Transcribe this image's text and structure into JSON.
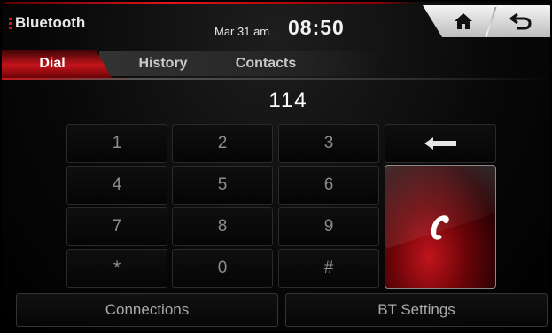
{
  "header": {
    "app_title": "Bluetooth",
    "date": "Mar 31 am",
    "time": "08:50",
    "home_icon": "home-icon",
    "back_icon": "back-arrow-icon",
    "accent_color": "#d2141c"
  },
  "tabs": [
    {
      "label": "Dial",
      "active": true
    },
    {
      "label": "History",
      "active": false
    },
    {
      "label": "Contacts",
      "active": false
    }
  ],
  "dialed_number": "114",
  "keypad": {
    "keys": [
      "1",
      "2",
      "3",
      "4",
      "5",
      "6",
      "7",
      "8",
      "9",
      "*",
      "0",
      "#"
    ],
    "backspace_icon": "backspace-arrow-icon",
    "call_icon": "phone-handset-icon"
  },
  "bottom": {
    "connections_label": "Connections",
    "bt_settings_label": "BT Settings"
  }
}
